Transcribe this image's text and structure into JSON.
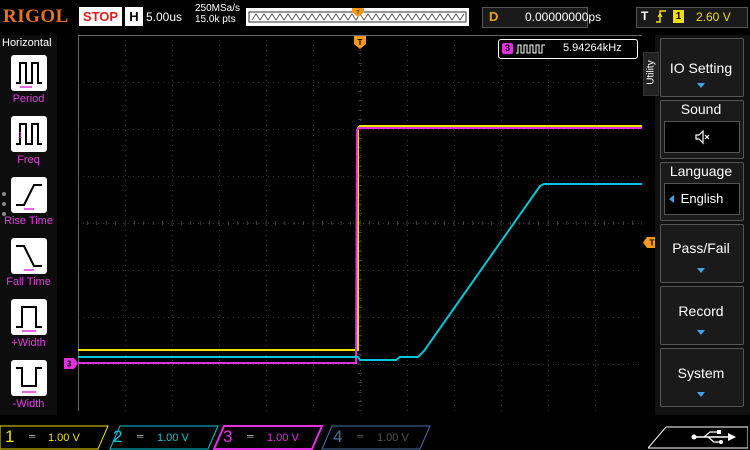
{
  "brand": "RIGOL",
  "run_state": "STOP",
  "horizontal": {
    "label": "H",
    "timebase": "5.00us",
    "sample_rate": "250MSa/s",
    "memory_depth": "15.0k pts"
  },
  "delay": {
    "label": "D",
    "value": "0.00000000ps"
  },
  "trigger": {
    "label": "T",
    "source": "1",
    "level": "2.60 V"
  },
  "measurement": {
    "channel": "3",
    "text": "5.94264kHz"
  },
  "left_menu": {
    "title": "Horizontal",
    "items": [
      {
        "label": "Period",
        "icon": "period-icon"
      },
      {
        "label": "Freq",
        "icon": "freq-icon"
      },
      {
        "label": "Rise Time",
        "icon": "rise-time-icon"
      },
      {
        "label": "Fall Time",
        "icon": "fall-time-icon"
      },
      {
        "label": "+Width",
        "icon": "positive-width-icon"
      },
      {
        "label": "-Width",
        "icon": "negative-width-icon"
      }
    ]
  },
  "right_menu": {
    "tab": "Utility",
    "io_setting": "IO Setting",
    "sound": "Sound",
    "language": "Language",
    "language_value": "English",
    "pass_fail": "Pass/Fail",
    "record": "Record",
    "system": "System"
  },
  "channels": [
    {
      "num": "1",
      "scale": "1.00 V",
      "color": "#f0e000"
    },
    {
      "num": "2",
      "scale": "1.00 V",
      "color": "#00c8d8"
    },
    {
      "num": "3",
      "scale": "1.00 V",
      "color": "#e030e0"
    },
    {
      "num": "4",
      "scale": "1.00 V",
      "color": "#4a6fa5"
    }
  ],
  "markers": {
    "trigger_pos": "T",
    "ch3_offset": "3",
    "trigger_level": "T"
  },
  "colors": {
    "brand": "#e8731a",
    "stop": "#e21b1b",
    "ch1": "#f0e000",
    "ch2": "#00c8d8",
    "ch3": "#e030e0",
    "ch4": "#4a6fa5",
    "marker": "#f39a1a",
    "accent": "#3aa6e8"
  }
}
